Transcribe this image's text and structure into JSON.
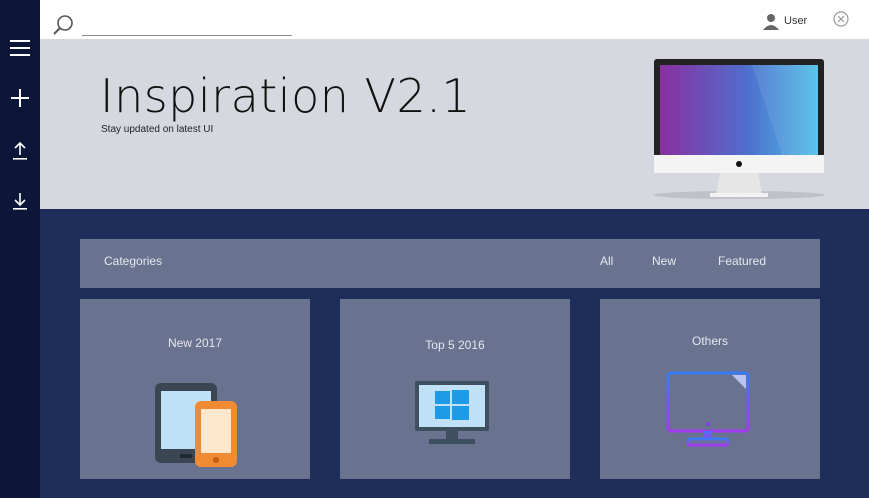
{
  "topbar": {
    "search_placeholder": "",
    "user_label": "User",
    "icons": {
      "search": "search-icon",
      "user": "user-icon",
      "close": "close-circle-icon"
    }
  },
  "sidebar": {
    "items": [
      {
        "name": "menu",
        "icon": "hamburger-icon"
      },
      {
        "name": "add",
        "icon": "plus-icon"
      },
      {
        "name": "upload",
        "icon": "upload-icon"
      },
      {
        "name": "download",
        "icon": "download-icon"
      }
    ]
  },
  "hero": {
    "title": "Inspiration V2.1",
    "subtitle": "Stay updated on latest UI",
    "illustration": "desktop-monitor-illustration"
  },
  "categories": {
    "label": "Categories",
    "filters": [
      "All",
      "New",
      "Featured"
    ]
  },
  "tiles": [
    {
      "label": "New 2017",
      "icon": "tablet-phone-icon"
    },
    {
      "label": "Top 5 2016",
      "icon": "windows-monitor-icon"
    },
    {
      "label": "Others",
      "icon": "gradient-monitor-icon"
    }
  ],
  "colors": {
    "sidebar": "#0b1638",
    "content_bg": "#1f2d5a",
    "hero_bg": "#d6d8df",
    "panel": "#69728f"
  }
}
